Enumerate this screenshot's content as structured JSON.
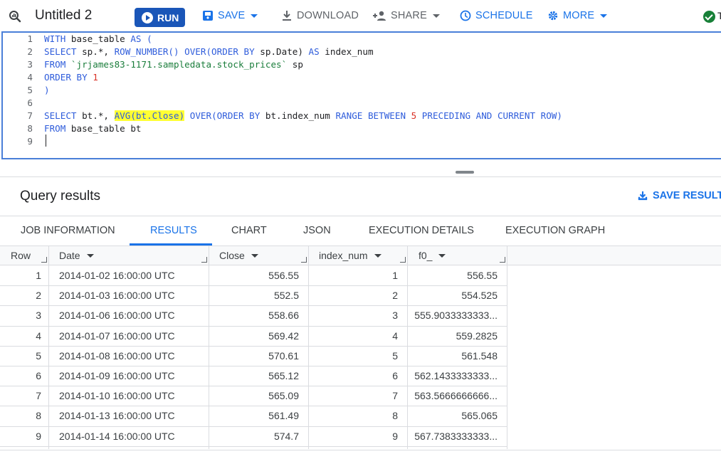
{
  "toolbar": {
    "title": "Untitled 2",
    "run": "RUN",
    "save": "SAVE",
    "download": "DOWNLOAD",
    "share": "SHARE",
    "schedule": "SCHEDULE",
    "more": "MORE",
    "trailing": "T"
  },
  "editor": {
    "lines": [
      {
        "num": "1",
        "tokens": [
          {
            "t": "WITH ",
            "c": "kw"
          },
          {
            "t": "base_table ",
            "c": "plain"
          },
          {
            "t": "AS (",
            "c": "kw"
          }
        ]
      },
      {
        "num": "2",
        "tokens": [
          {
            "t": "SELECT ",
            "c": "kw"
          },
          {
            "t": "sp.*, ",
            "c": "plain"
          },
          {
            "t": "ROW_NUMBER() OVER(ORDER BY ",
            "c": "kw"
          },
          {
            "t": "sp.Date) ",
            "c": "plain"
          },
          {
            "t": "AS ",
            "c": "kw"
          },
          {
            "t": "index_num",
            "c": "plain"
          }
        ]
      },
      {
        "num": "3",
        "tokens": [
          {
            "t": "FROM ",
            "c": "kw"
          },
          {
            "t": "`jrjames83-1171.sampledata.stock_prices`",
            "c": "str"
          },
          {
            "t": " sp",
            "c": "plain"
          }
        ]
      },
      {
        "num": "4",
        "tokens": [
          {
            "t": "ORDER BY ",
            "c": "kw"
          },
          {
            "t": "1",
            "c": "num"
          }
        ]
      },
      {
        "num": "5",
        "tokens": [
          {
            "t": ")",
            "c": "kw"
          }
        ]
      },
      {
        "num": "6",
        "tokens": []
      },
      {
        "num": "7",
        "tokens": [
          {
            "t": "SELECT ",
            "c": "kw"
          },
          {
            "t": "bt.*, ",
            "c": "plain"
          },
          {
            "t": "AVG(bt.Close)",
            "c": "kw hl"
          },
          {
            "t": " OVER(ORDER BY ",
            "c": "kw"
          },
          {
            "t": "bt.index_num ",
            "c": "plain"
          },
          {
            "t": "RANGE BETWEEN ",
            "c": "kw"
          },
          {
            "t": "5",
            "c": "num"
          },
          {
            "t": " PRECEDING AND CURRENT ROW)",
            "c": "kw"
          }
        ]
      },
      {
        "num": "8",
        "tokens": [
          {
            "t": "FROM ",
            "c": "kw"
          },
          {
            "t": "base_table bt",
            "c": "plain"
          }
        ]
      },
      {
        "num": "9",
        "tokens": []
      }
    ]
  },
  "results": {
    "title": "Query results",
    "save_results": "SAVE RESULTS",
    "tabs": [
      "JOB INFORMATION",
      "RESULTS",
      "CHART",
      "JSON",
      "EXECUTION DETAILS",
      "EXECUTION GRAPH"
    ],
    "active_tab": "RESULTS",
    "columns": [
      "Row",
      "Date",
      "Close",
      "index_num",
      "f0_"
    ],
    "rows": [
      [
        "1",
        "2014-01-02 16:00:00 UTC",
        "556.55",
        "1",
        "556.55"
      ],
      [
        "2",
        "2014-01-03 16:00:00 UTC",
        "552.5",
        "2",
        "554.525"
      ],
      [
        "3",
        "2014-01-06 16:00:00 UTC",
        "558.66",
        "3",
        "555.9033333333..."
      ],
      [
        "4",
        "2014-01-07 16:00:00 UTC",
        "569.42",
        "4",
        "559.2825"
      ],
      [
        "5",
        "2014-01-08 16:00:00 UTC",
        "570.61",
        "5",
        "561.548"
      ],
      [
        "6",
        "2014-01-09 16:00:00 UTC",
        "565.12",
        "6",
        "562.1433333333..."
      ],
      [
        "7",
        "2014-01-10 16:00:00 UTC",
        "565.09",
        "7",
        "563.5666666666..."
      ],
      [
        "8",
        "2014-01-13 16:00:00 UTC",
        "561.49",
        "8",
        "565.065"
      ],
      [
        "9",
        "2014-01-14 16:00:00 UTC",
        "574.7",
        "9",
        "567.7383333333..."
      ]
    ]
  },
  "colors": {
    "accent": "#1a73e8",
    "run_button": "#1a56b8",
    "highlight": "#ffff33",
    "success": "#188038"
  }
}
